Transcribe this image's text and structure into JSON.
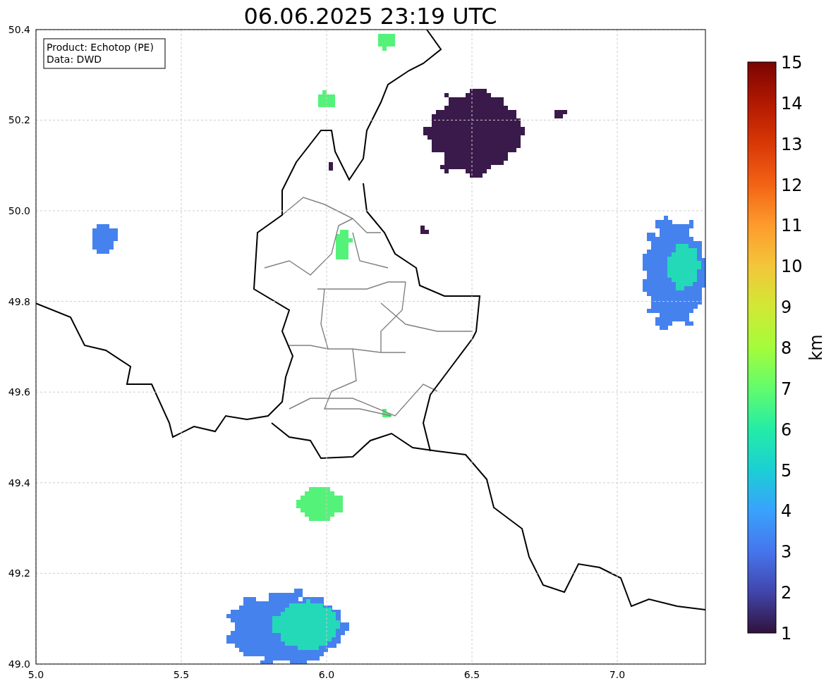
{
  "title": "06.06.2025 23:19 UTC",
  "info_box": {
    "lines": [
      "Product: Echotop (PE)",
      "Data: DWD"
    ]
  },
  "map": {
    "x_ticks": [
      "5.0",
      "5.5",
      "6.0",
      "6.5",
      "7.0"
    ],
    "y_ticks": [
      "50.4",
      "50.2",
      "50.0",
      "49.8",
      "49.6",
      "49.4",
      "49.2",
      "49.0"
    ]
  },
  "colorbar": {
    "label": "km",
    "ticks": [
      "15",
      "14",
      "13",
      "12",
      "11",
      "10",
      "9",
      "8",
      "7",
      "6",
      "5",
      "4",
      "3",
      "2",
      "1"
    ]
  }
}
